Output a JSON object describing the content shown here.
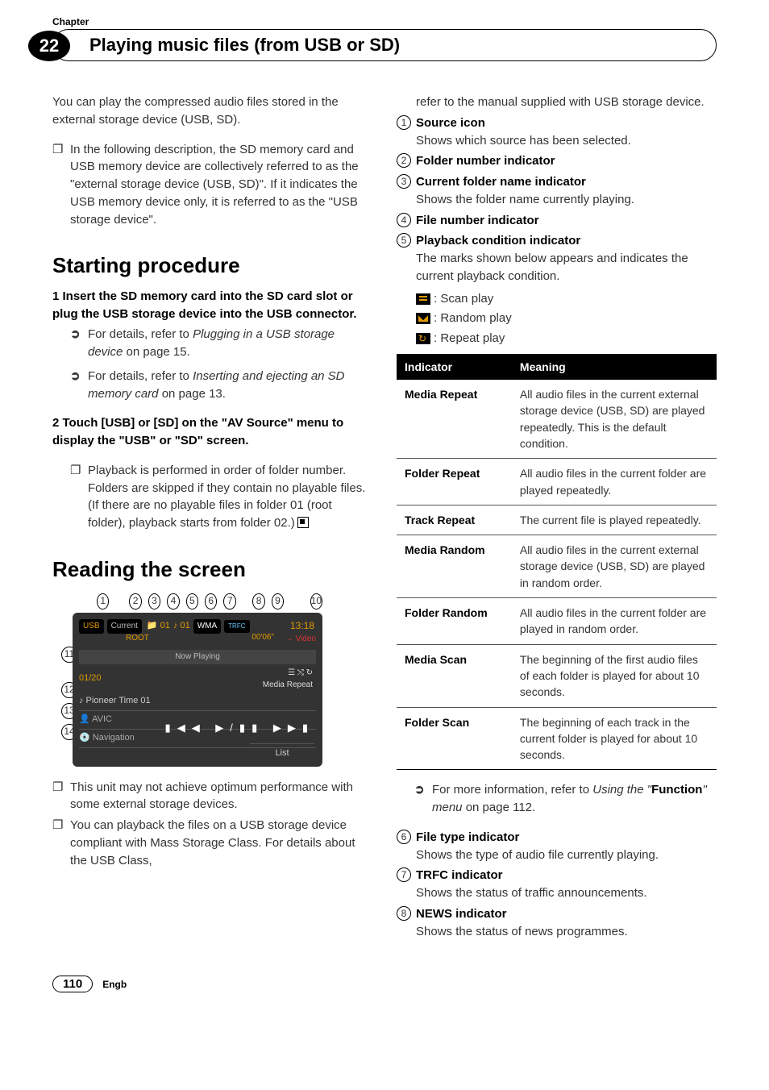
{
  "header": {
    "chapter_label": "Chapter",
    "chapter_number": "22",
    "title": "Playing music files (from USB or SD)"
  },
  "left": {
    "intro": "You can play the compressed audio files stored in the external storage device (USB, SD).",
    "intro_bullet": "In the following description, the SD memory card and USB memory device are collectively referred to as the \"external storage device (USB, SD)\". If it indicates the USB memory device only, it is referred to as the \"USB storage device\".",
    "section1_title": "Starting procedure",
    "step1_head": "1    Insert the SD memory card into the SD card slot or plug the USB storage device into the USB connector.",
    "step1_a_pref": "For details, refer to ",
    "step1_a_ital": "Plugging in a USB storage device",
    "step1_a_suf": " on page 15.",
    "step1_b_pref": "For details, refer to ",
    "step1_b_ital": "Inserting and ejecting an SD memory card",
    "step1_b_suf": " on page 13.",
    "step2_head": "2    Touch [USB] or [SD] on the \"AV Source\" menu to display the \"USB\" or \"SD\" screen.",
    "step2_bullet": "Playback is performed in order of folder number. Folders are skipped if they contain no playable files. (If there are no playable files in folder 01 (root folder), playback starts from folder 02.)",
    "section2_title": "Reading the screen",
    "screenshot": {
      "source_badge": "USB",
      "current_badge": "Current",
      "folder_prefix": "📁 01",
      "folder_name": "ROOT",
      "track_prefix": "♪ 01",
      "codec_badge": "WMA",
      "trfc_badge": "TRFC",
      "clock": "13:18",
      "elapsed": "00'06\"",
      "video_link": "→ Video",
      "now_playing": "Now Playing",
      "track_count": "01/20",
      "playback_mode": "Media Repeat",
      "line1": "♪ Pioneer Time 01",
      "line2": "👤 AVIC",
      "line3": "💿 Navigation",
      "controls": "▮◀◀   ▶/▮▮   ▶▶▮",
      "list_btn": "List"
    },
    "after_bullet1": "This unit may not achieve optimum performance with some external storage devices.",
    "after_bullet2": "You can playback the files on a USB storage device compliant with Mass Storage Class. For details about the USB Class,"
  },
  "right": {
    "cont": "refer to the manual supplied with USB storage device.",
    "items": {
      "i1_t": "Source icon",
      "i1_d": "Shows which source has been selected.",
      "i2_t": "Folder number indicator",
      "i3_t": "Current folder name indicator",
      "i3_d": "Shows the folder name currently playing.",
      "i4_t": "File number indicator",
      "i5_t": "Playback condition indicator",
      "i5_d": "The marks shown below appears and indicates the current playback condition."
    },
    "icons": {
      "scan": ": Scan play",
      "random": ": Random play",
      "repeat": ": Repeat play"
    },
    "table": {
      "h1": "Indicator",
      "h2": "Meaning",
      "r1a": "Media Repeat",
      "r1b": "All audio files in the current external storage device (USB, SD) are played repeatedly. This is the default condition.",
      "r2a": "Folder Repeat",
      "r2b": "All audio files in the current folder are played repeatedly.",
      "r3a": "Track Repeat",
      "r3b": "The current file is played repeatedly.",
      "r4a": "Media Random",
      "r4b": "All audio files in the current external storage device (USB, SD) are played in random order.",
      "r5a": "Folder Random",
      "r5b": "All audio files in the current folder are played in random order.",
      "r6a": "Media Scan",
      "r6b": "The beginning of the first audio files of each folder is played for about 10 seconds.",
      "r7a": "Folder Scan",
      "r7b": "The beginning of each track in the current folder is played for about 10 seconds."
    },
    "moreinfo_pref": "For more information, refer to ",
    "moreinfo_ital1": "Using the \"",
    "moreinfo_bold": "Function",
    "moreinfo_ital2": "\" menu",
    "moreinfo_suf": " on page 112.",
    "i6_t": "File type indicator",
    "i6_d": "Shows the type of audio file currently playing.",
    "i7_t": "TRFC indicator",
    "i7_d": "Shows the status of traffic announcements.",
    "i8_t": "NEWS indicator",
    "i8_d": "Shows the status of news programmes."
  },
  "footer": {
    "page": "110",
    "lang": "Engb"
  }
}
